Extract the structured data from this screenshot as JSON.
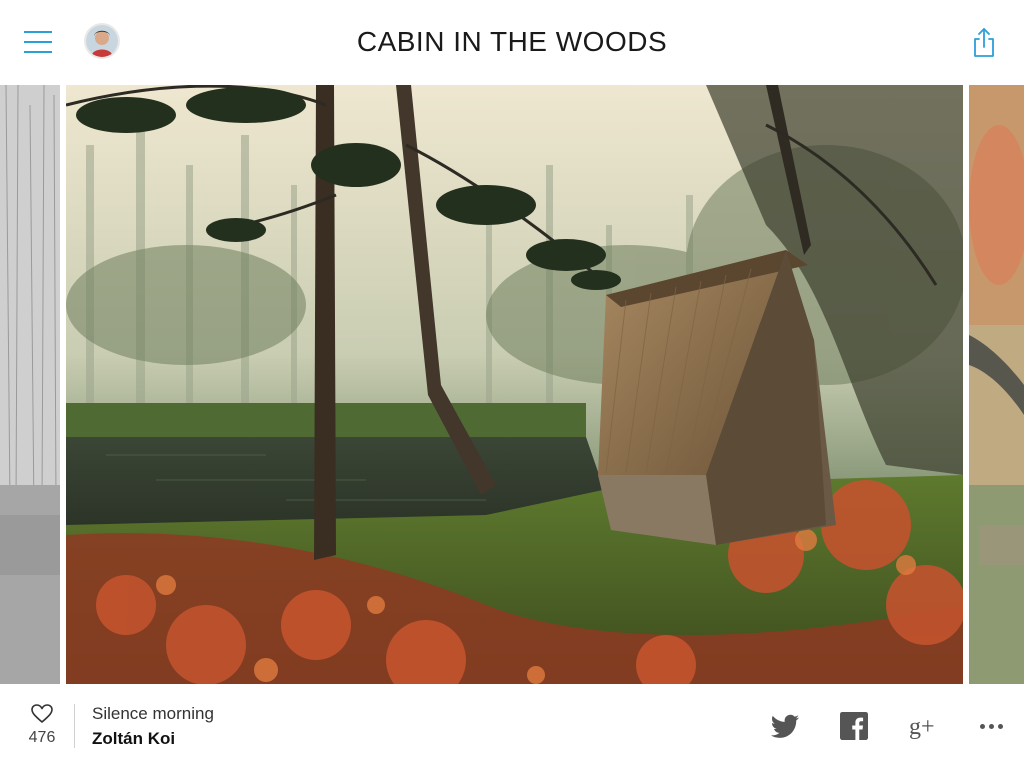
{
  "header": {
    "title": "CABIN IN THE WOODS",
    "menu_icon": "hamburger-menu-icon",
    "avatar_icon": "user-avatar",
    "share_icon": "share-icon"
  },
  "gallery": {
    "main_photo_label": "Cabin in the Woods",
    "colors": {
      "accent": "#2b9fd8",
      "leaves": "#b8452a",
      "grass": "#5e7a2e",
      "fog": "#e9e3d0"
    }
  },
  "footer": {
    "likes": "476",
    "like_icon": "heart-icon",
    "caption": "Silence morning",
    "author": "Zoltán Koi",
    "social": {
      "twitter_icon": "twitter-icon",
      "facebook_icon": "facebook-icon",
      "gplus_label": "g+",
      "more_icon": "more-dots-icon"
    }
  }
}
